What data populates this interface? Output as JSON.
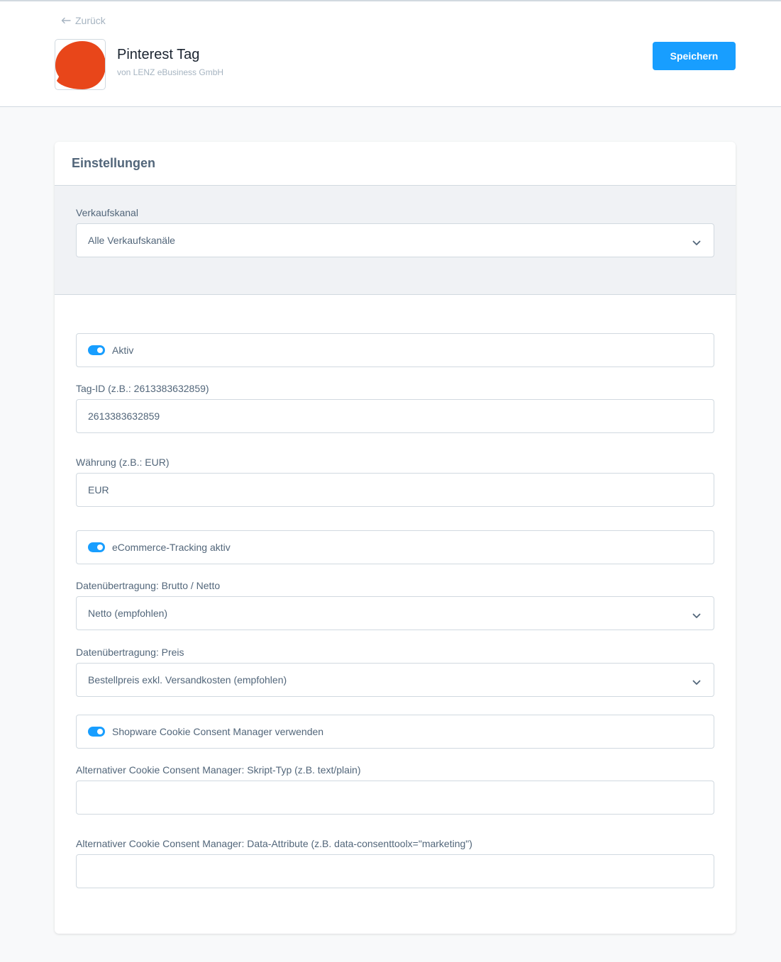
{
  "header": {
    "back_label": "Zurück",
    "plugin_name": "Pinterest Tag",
    "vendor": "von LENZ eBusiness GmbH",
    "save_label": "Speichern",
    "accent_color": "#189eff",
    "icon_color": "#e8461a"
  },
  "card": {
    "title": "Einstellungen",
    "sales_channel": {
      "label": "Verkaufskanal",
      "value": "Alle Verkaufskanäle"
    },
    "fields": {
      "active": {
        "label": "Aktiv",
        "checked": true
      },
      "tag_id": {
        "label": "Tag-ID (z.B.: 2613383632859)",
        "value": "2613383632859"
      },
      "currency": {
        "label": "Währung (z.B.: EUR)",
        "value": "EUR"
      },
      "ecommerce_tracking": {
        "label": "eCommerce-Tracking aktiv",
        "checked": true
      },
      "gross_net": {
        "label": "Datenübertragung: Brutto / Netto",
        "value": "Netto (empfohlen)"
      },
      "price": {
        "label": "Datenübertragung: Preis",
        "value": "Bestellpreis exkl. Versandkosten (empfohlen)"
      },
      "cookie_consent": {
        "label": "Shopware Cookie Consent Manager verwenden",
        "checked": true
      },
      "script_type": {
        "label": "Alternativer Cookie Consent Manager: Skript-Typ (z.B. text/plain)",
        "value": ""
      },
      "data_attribute": {
        "label": "Alternativer Cookie Consent Manager: Data-Attribute (z.B. data-consenttoolx=\"marketing\")",
        "value": ""
      }
    }
  }
}
